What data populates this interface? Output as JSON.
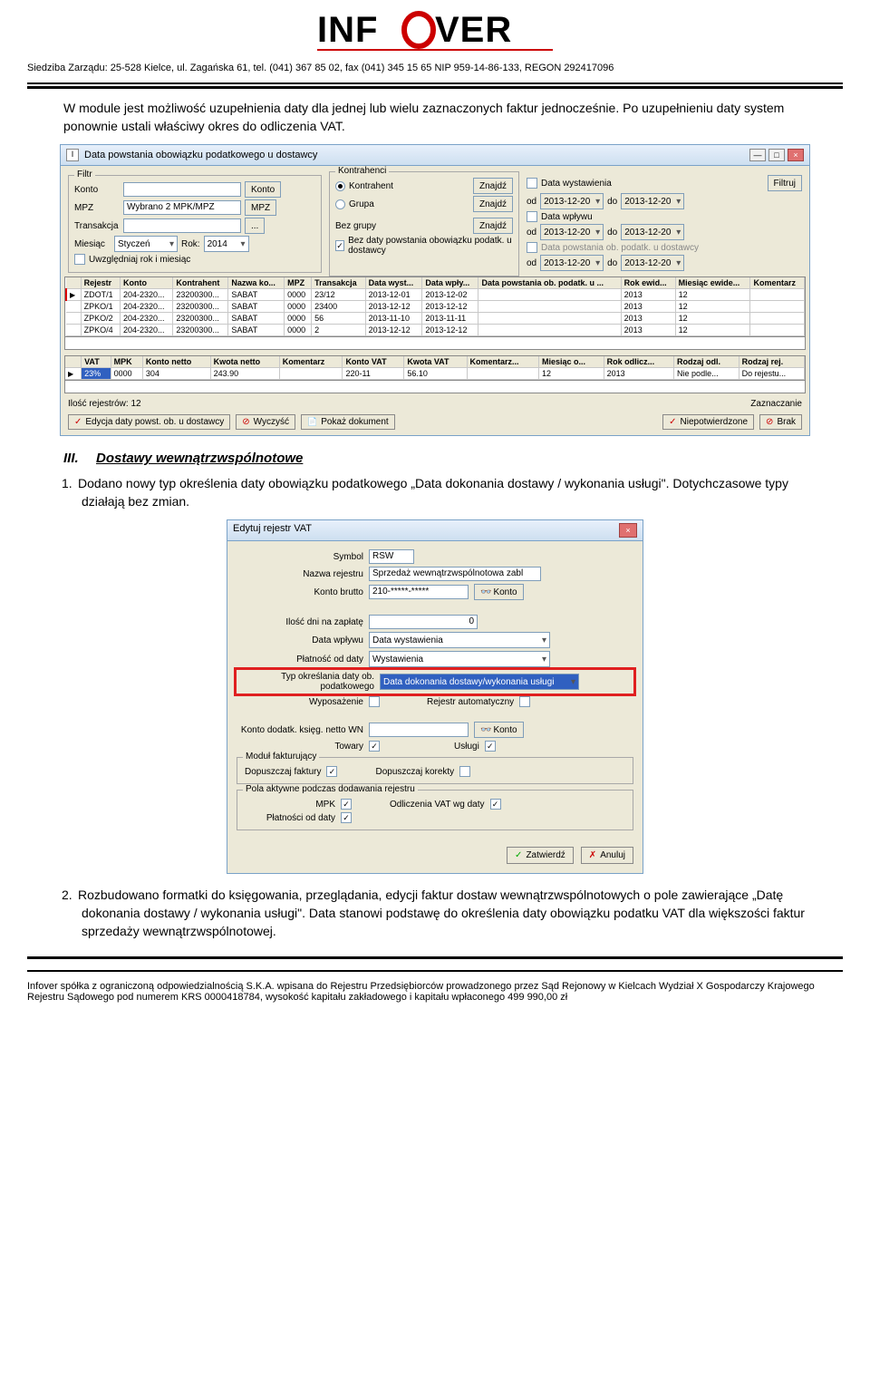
{
  "header": {
    "logo_text": "INFOVER",
    "address_line": "Siedziba Zarządu: 25-528 Kielce, ul. Zagańska 61, tel. (041) 367 85 02, fax (041) 345 15 65  NIP 959-14-86-133, REGON 292417096"
  },
  "intro": "W module jest możliwość uzupełnienia daty dla jednej lub wielu zaznaczonych faktur jednocześnie. Po uzupełnieniu daty system ponownie ustali właściwy okres do odliczenia VAT.",
  "app1": {
    "title_prefix": "I",
    "title": "Data powstania obowiązku podatkowego u dostawcy",
    "win_min": "—",
    "win_max": "□",
    "win_close": "×",
    "filter_legend": "Filtr",
    "labels": {
      "konto": "Konto",
      "konto_btn": "Konto",
      "mpz": "MPZ",
      "mpz_val": "Wybrano 2 MPK/MPZ",
      "mpz_btn": "MPZ",
      "transakcja": "Transakcja",
      "trans_btn": "...",
      "miesiac": "Miesiąc",
      "miesiac_val": "Styczeń",
      "rok": "Rok:",
      "rok_val": "2014",
      "bez_grupy": "Bez grupy",
      "uwz": "Uwzględniaj rok i miesiąc",
      "bez_daty": "Bez daty powstania obowiązku podatk. u dostawcy",
      "kontrahenci": "Kontrahenci",
      "kontrahent": "Kontrahent",
      "grupa": "Grupa",
      "znajdz": "Znajdź",
      "data_wyst": "Data wystawienia",
      "data_wplywu": "Data wpływu",
      "data_pop": "Data powstania ob. podatk. u dostawcy",
      "od": "od",
      "do": "do",
      "od_v": "2013-12-20",
      "do_v": "2013-12-20",
      "filtruj": "Filtruj"
    },
    "grid1_headers": [
      "",
      "Rejestr",
      "Konto",
      "Kontrahent",
      "Nazwa ko...",
      "MPZ",
      "Transakcja",
      "Data wyst...",
      "Data wpły...",
      "Data powstania ob. podatk. u ...",
      "Rok ewid...",
      "Miesiąc ewide...",
      "Komentarz"
    ],
    "grid1_rows": [
      [
        "▶",
        "ZDOT/1",
        "204-2320...",
        "23200300...",
        "SABAT",
        "0000",
        "23/12",
        "2013-12-01",
        "2013-12-02",
        "",
        "2013",
        "12",
        ""
      ],
      [
        "",
        "ZPKO/1",
        "204-2320...",
        "23200300...",
        "SABAT",
        "0000",
        "23400",
        "2013-12-12",
        "2013-12-12",
        "",
        "2013",
        "12",
        ""
      ],
      [
        "",
        "ZPKO/2",
        "204-2320...",
        "23200300...",
        "SABAT",
        "0000",
        "56",
        "2013-11-10",
        "2013-11-11",
        "",
        "2013",
        "12",
        ""
      ],
      [
        "",
        "ZPKO/4",
        "204-2320...",
        "23200300...",
        "SABAT",
        "0000",
        "2",
        "2013-12-12",
        "2013-12-12",
        "",
        "2013",
        "12",
        ""
      ]
    ],
    "grid2_headers": [
      "",
      "VAT",
      "MPK",
      "Konto netto",
      "Kwota netto",
      "Komentarz",
      "Konto VAT",
      "Kwota VAT",
      "Komentarz...",
      "Miesiąc o...",
      "Rok odlicz...",
      "Rodzaj odl.",
      "Rodzaj rej."
    ],
    "grid2_row": [
      "▶",
      "23%",
      "0000",
      "304",
      "243.90",
      "",
      "220-11",
      "56.10",
      "",
      "12",
      "2013",
      "Nie podle...",
      "Do rejestu..."
    ],
    "status": "Ilość rejestrów: 12",
    "zazn": "Zaznaczanie",
    "buttons": {
      "edit": "Edycja daty powst. ob. u dostawcy",
      "wyczysc": "Wyczyść",
      "pokaz": "Pokaż dokument",
      "niepot": "Niepotwierdzone",
      "brak": "Brak"
    }
  },
  "section3": {
    "num": "III.",
    "title": "Dostawy wewnątrzwspólnotowe",
    "item1_num": "1.",
    "item1": "Dodano nowy typ określenia daty obowiązku podatkowego „Data dokonania dostawy / wykonania usługi\". Dotychczasowe typy działają bez zmian.",
    "item2_num": "2.",
    "item2": "Rozbudowano formatki do księgowania, przeglądania, edycji faktur dostaw wewnątrzwspólnotowych o pole zawierające „Datę dokonania dostawy / wykonania usługi\". Data stanowi podstawę do określenia daty obowiązku podatku VAT dla większości faktur sprzedaży wewnątrzwspólnotowej."
  },
  "dialog": {
    "title": "Edytuj rejestr VAT",
    "close": "×",
    "symbol_l": "Symbol",
    "symbol_v": "RSW",
    "nazwa_l": "Nazwa rejestru",
    "nazwa_v": "Sprzedaż wewnątrzwspólnotowa zabl",
    "konto_l": "Konto brutto",
    "konto_v": "210-*****-*****",
    "konto_btn": "Konto",
    "ilosc_l": "Ilość dni na zapłatę",
    "ilosc_v": "0",
    "datawp_l": "Data wpływu",
    "datawp_v": "Data wystawienia",
    "platn_l": "Płatność od daty",
    "platn_v": "Wystawienia",
    "typ_l": "Typ określania daty ob. podatkowego",
    "typ_v": "Data dokonania dostawy/wykonania usługi",
    "wypos_l": "Wyposażenie",
    "rejaut_l": "Rejestr automatyczny",
    "kontod_l": "Konto dodatk. księg. netto WN",
    "kontod_btn": "Konto",
    "towary_l": "Towary",
    "uslugi_l": "Usługi",
    "modul_legend": "Moduł fakturujący",
    "dopfak": "Dopuszczaj faktury",
    "dopkor": "Dopuszczaj korekty",
    "pola_legend": "Pola aktywne podczas dodawania rejestru",
    "mpk": "MPK",
    "odlvat": "Odliczenia VAT wg daty",
    "platod": "Płatności od daty",
    "zatw": "Zatwierdź",
    "anul": "Anuluj"
  },
  "footer": {
    "line": "Infover  spółka z ograniczoną odpowiedzialnością S.K.A.  wpisana do  Rejestru Przedsiębiorców prowadzonego przez Sąd Rejonowy w Kielcach Wydział X Gospodarczy Krajowego Rejestru Sądowego pod numerem KRS 0000418784, wysokość kapitału zakładowego i kapitału wpłaconego 499 990,00 zł"
  }
}
